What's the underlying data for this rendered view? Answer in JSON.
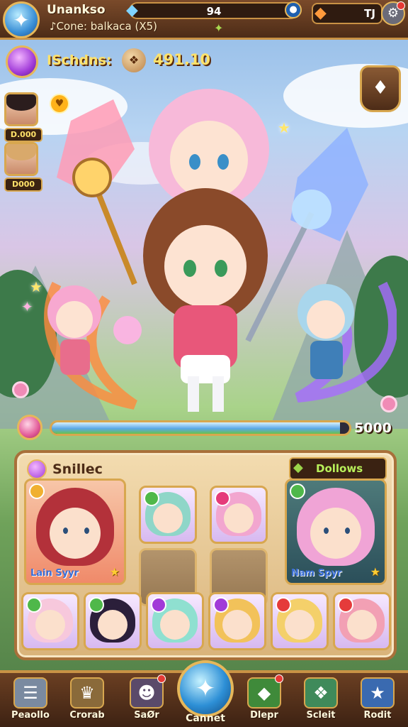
{
  "header": {
    "player_name": "Unankso",
    "player_subtitle": "♪Cone: balkaca (X5)",
    "gem_count": "94",
    "gem_icon": "diamond-icon",
    "resource_value": "TJ",
    "resource_icon": "amber-gem-icon",
    "settings_icon": "gear-icon"
  },
  "stats": {
    "label": "ISchdns:",
    "value": "491.10"
  },
  "friends": [
    {
      "value": "D.000",
      "hair_color": "#2b1d1d"
    },
    {
      "value": "D000",
      "hair_color": "#d9a96b"
    }
  ],
  "progress": {
    "fraction": 0.97,
    "value": "5000"
  },
  "team_panel": {
    "title": "Snillec",
    "right_label": "Dollows",
    "large_cards": [
      {
        "name": "Lain Syyr",
        "hair": "#b3313a",
        "bg": "#f0b7a0"
      },
      {
        "name": "Nam Spyr",
        "hair": "#f0a4d6",
        "bg": "#6fa7a0"
      }
    ],
    "mid_cards": [
      {
        "hair": "#8fd6c8",
        "elem": "#4fb84a"
      },
      {
        "hair": "#f2a6cf",
        "elem": "#e53b7a"
      }
    ],
    "bottom_cards": [
      {
        "hair": "#f7c8dc",
        "elem": "#4fb84a"
      },
      {
        "hair": "#2b1f3a",
        "elem": "#4fb84a"
      },
      {
        "hair": "#8fe0d0",
        "elem": "#a13bd8"
      },
      {
        "hair": "#f2c25a",
        "elem": "#a13bd8"
      },
      {
        "hair": "#f4d06a",
        "elem": "#e53b3b"
      },
      {
        "hair": "#f2a0b4",
        "elem": "#e53b3b"
      }
    ]
  },
  "nav": {
    "items": [
      {
        "label": "Peaollo",
        "icon": "scroll-icon",
        "color": "#7a8aa0"
      },
      {
        "label": "Crorab",
        "icon": "crown-icon",
        "color": "#8a6a3a"
      },
      {
        "label": "SaØr",
        "icon": "portrait-icon",
        "color": "#5a4a6a"
      },
      {
        "label": "Dlepr",
        "icon": "green-gem-icon",
        "color": "#3f8a3a"
      },
      {
        "label": "Scleit",
        "icon": "crystal-icon",
        "color": "#3f8a5a"
      },
      {
        "label": "Rodit",
        "icon": "star-icon",
        "color": "#3a6ab0"
      }
    ],
    "center_label": "Cannet",
    "center_icon": "blue-crystal-icon"
  }
}
